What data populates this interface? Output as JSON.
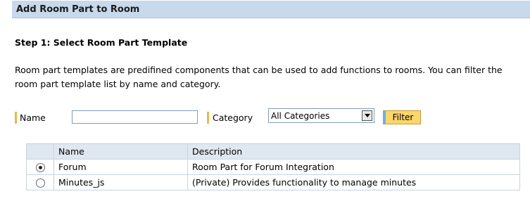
{
  "header": {
    "title": "Add Room Part to Room"
  },
  "step": {
    "title": "Step 1: Select Room Part Template",
    "description": "Room part templates are predifined components that can be used to add functions to rooms. You can filter the room part template list by name and category."
  },
  "filters": {
    "name_label": "Name",
    "name_value": "",
    "category_label": "Category",
    "category_value": "All Categories",
    "filter_button": "Filter"
  },
  "table": {
    "columns": [
      "",
      "Name",
      "Description"
    ],
    "rows": [
      {
        "selected": true,
        "name": "Forum",
        "description": "Room Part for Forum Integration"
      },
      {
        "selected": false,
        "name": "Minutes_js",
        "description": "(Private) Provides functionality to manage minutes"
      }
    ]
  },
  "colors": {
    "header_bg": "#c8d9ec",
    "filter_button": "#fbd66a",
    "label_bar": "#e5b94c"
  }
}
